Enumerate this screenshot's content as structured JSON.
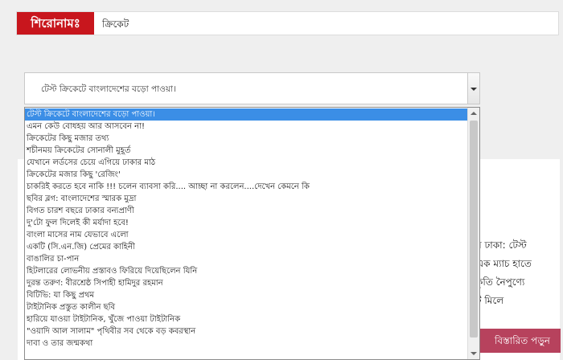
{
  "header": {
    "label": "শিরোনামঃ",
    "value": "ক্রিকেট"
  },
  "select": {
    "value": "টেস্ট ক্রিকেটে বাংলাদেশের বড়ো পাওয়া।"
  },
  "dropdown": {
    "options": [
      "টেস্ট ক্রিকেটে বাংলাদেশের বড়ো পাওয়া।",
      "এমন কেউ বোধহয় আর আসবেন না!",
      "ক্রিকেটের কিছু মজার তথ্য",
      "শচীনময় ক্রিকেটের সোনালী মুহূর্ত",
      "যেখানে লর্ডসের চেয়ে এগিয়ে ঢাকার মাঠ",
      "ক্রিকেটের মজার কিছু 'রেজিং'",
      "চাকরিই করতে হবে নাকি !!! চলেন ব্যাবসা করি.... আচ্ছা না করলেন....দেখেন কেমনে কি",
      "ছবির ব্লগ: বাংলাদেশের স্মারক মুদ্রা",
      "বিগত চারশ বছরে ঢাকার বন্যপ্রাণী",
      "দু'টো ফুল দিলেই কী মর্যাদা হবে!",
      "বাংলা মাসের নাম যেভাবে এলো",
      "একটি (সি.এন.জি) প্রেমের কাহিনী",
      "বাঙালির চা-পান",
      "হিটলারের লোভনীয় প্রস্তাবও ফিরিয়ে দিয়েছিলেন যিনি",
      "দুরন্ত তরুণ: বীরশ্রেষ্ঠ সিপাহী হামিদুর রহমান",
      "বিটিভি: যা কিছু প্রথম",
      "টাইটানিক প্রস্তুত কালীন ছবি",
      "হারিয়ে যাওয়া টাইটানিক, খুঁজে পাওয়া টাইটানিক",
      "\"ওয়াদি আল সালাম\" পৃথিবীর সব থেকে বড় কবরস্থান",
      "দাবা ও তার জন্মকথা"
    ]
  },
  "card": {
    "text_lines": [
      "ম  ঢাকা: টেস্ট",
      "এক ম্যাচ হাতে",
      "কৃতি নৈপুণ্যে",
      "ট মিলে"
    ],
    "button": "বিস্তারিত পড়ুন"
  }
}
